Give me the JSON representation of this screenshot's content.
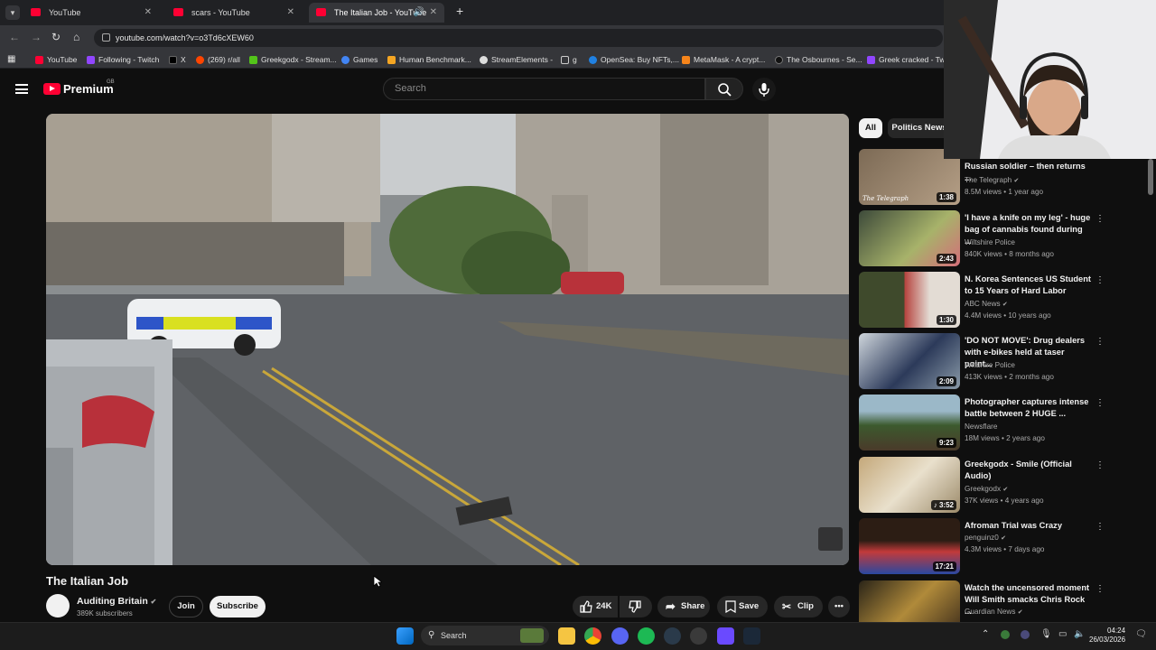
{
  "browser": {
    "tabs": [
      {
        "title": "YouTube"
      },
      {
        "title": "scars - YouTube"
      },
      {
        "title": "The Italian Job - YouTube"
      }
    ],
    "url": "youtube.com/watch?v=o3Td6cXEW60",
    "bookmarks": [
      "YouTube",
      "Following - Twitch",
      "X",
      "(269) r/all",
      "Greekgodx - Stream...",
      "Games",
      "Human Benchmark...",
      "StreamElements -",
      "g",
      "OpenSea: Buy NFTs,...",
      "MetaMask - A crypt...",
      "The Osbournes - Se...",
      "Greek cracked - Twi..."
    ]
  },
  "youtube": {
    "logo_text": "Premium",
    "region": "GB",
    "search_placeholder": "Search",
    "chips": [
      "All",
      "Politics News"
    ],
    "video": {
      "title": "The Italian Job",
      "channel": "Auditing Britain",
      "subscribers": "389K subscribers",
      "join": "Join",
      "subscribe": "Subscribe",
      "likes": "24K",
      "share": "Share",
      "save": "Save",
      "clip": "Clip"
    },
    "recommended": [
      {
        "title": "Russian soldier – then returns ...",
        "channel": "The Telegraph",
        "meta": "8.5M views • 1 year ago",
        "duration": "1:38",
        "thumb_text": "The Telegraph"
      },
      {
        "title": "'I have a knife on my leg' - huge bag of cannabis found during ...",
        "channel": "Wiltshire Police",
        "meta": "840K views • 8 months ago",
        "duration": "2:43"
      },
      {
        "title": "N. Korea Sentences US Student to 15 Years of Hard Labor",
        "channel": "ABC News",
        "meta": "4.4M views • 10 years ago",
        "duration": "1:30"
      },
      {
        "title": "'DO NOT MOVE': Drug dealers with e-bikes held at taser point...",
        "channel": "Wiltshire Police",
        "meta": "413K views • 2 months ago",
        "duration": "2:09"
      },
      {
        "title": "Photographer captures intense battle between 2 HUGE ...",
        "channel": "Newsflare",
        "meta": "18M views • 2 years ago",
        "duration": "9:23"
      },
      {
        "title": "Greekgodx - Smile (Official Audio)",
        "channel": "Greekgodx",
        "meta": "37K views • 4 years ago",
        "duration": "3:52"
      },
      {
        "title": "Afroman Trial was Crazy",
        "channel": "penguinz0",
        "meta": "4.3M views • 7 days ago",
        "duration": "17:21"
      },
      {
        "title": "Watch the uncensored moment Will Smith smacks Chris Rock ...",
        "channel": "Guardian News",
        "meta": "",
        "duration": ""
      }
    ]
  },
  "taskbar": {
    "search": "Search",
    "time": "04:24",
    "date": "26/03/2026"
  }
}
